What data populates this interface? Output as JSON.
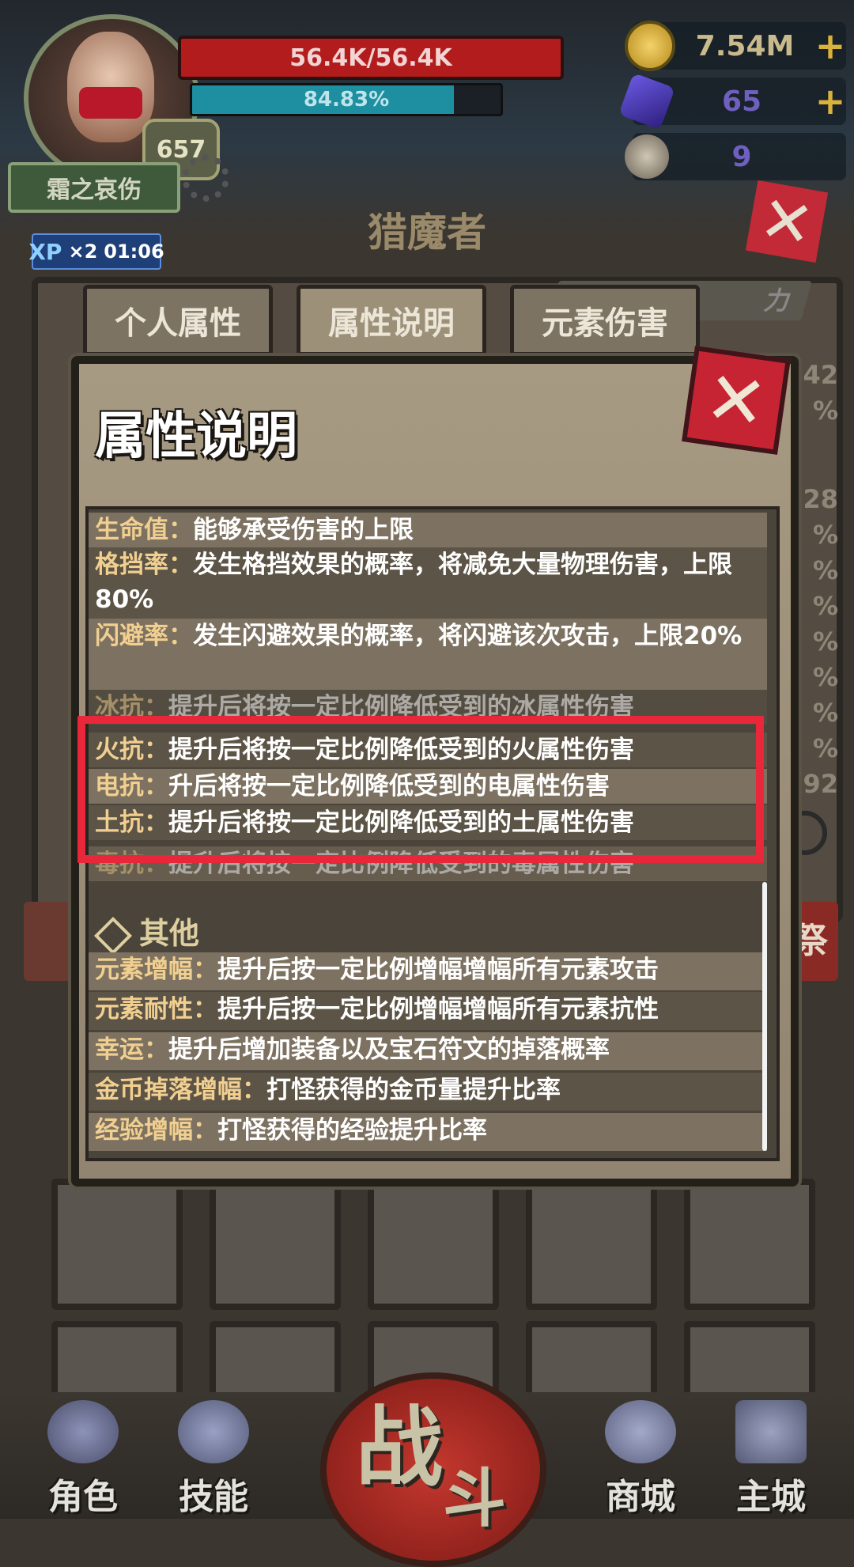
{
  "hud": {
    "hp_text": "56.4K/56.4K",
    "xp_text": "84.83%",
    "xp_progress": 0.8483,
    "level": "657",
    "player_name": "霜之哀伤",
    "resources": [
      {
        "icon": "gold-coin-icon",
        "value": "7.54M",
        "has_plus": true,
        "plus_label": "+"
      },
      {
        "icon": "purple-gem-icon",
        "value": "65",
        "has_plus": true,
        "plus_label": "+"
      },
      {
        "icon": "ram-skull-icon",
        "value": "9",
        "has_plus": false,
        "plus_label": ""
      }
    ],
    "xp_boost": {
      "label": "XP",
      "multiplier": "×2",
      "timer": "01:06"
    },
    "close_label": "✕"
  },
  "window": {
    "title": "猎魔者",
    "tabs": [
      {
        "label": "个人属性",
        "active": false
      },
      {
        "label": "属性说明",
        "active": true
      },
      {
        "label": "元素伤害",
        "active": false
      }
    ],
    "power_tag": "力",
    "side_right_label": "祭",
    "back_numbers": [
      "42",
      "%",
      "28",
      "%",
      "%",
      "%",
      "%",
      "%",
      "%",
      "%",
      "92"
    ]
  },
  "modal": {
    "title": "属性说明",
    "close_label": "✕",
    "rows": [
      {
        "key": "生命值：",
        "text": "能够承受伤害的上限"
      },
      {
        "key": "格挡率：",
        "text": "发生格挡效果的概率，将减免大量物理伤害，上限80%"
      },
      {
        "key": "闪避率：",
        "text": "发生闪避效果的概率，将闪避该次攻击，上限20%"
      },
      {
        "key": "冰抗：",
        "text": "提升后将按一定比例降低受到的冰属性伤害"
      },
      {
        "key": "火抗：",
        "text": "提升后将按一定比例降低受到的火属性伤害"
      },
      {
        "key": "电抗：",
        "text": "升后将按一定比例降低受到的电属性伤害"
      },
      {
        "key": "土抗：",
        "text": "提升后将按一定比例降低受到的土属性伤害"
      },
      {
        "key": "毒抗：",
        "text": "提升后将按一定比例降低受到的毒属性伤害"
      }
    ],
    "section_other": "其他",
    "other_rows": [
      {
        "key": "元素增幅：",
        "text": "提升后按一定比例增幅增幅所有元素攻击"
      },
      {
        "key": "元素耐性：",
        "text": "提升后按一定比例增幅增幅所有元素抗性"
      },
      {
        "key": "幸运：",
        "text": "提升后增加装备以及宝石符文的掉落概率"
      },
      {
        "key": "金币掉落增幅：",
        "text": "打怪获得的金币量提升比率"
      },
      {
        "key": "经验增幅：",
        "text": "打怪获得的经验提升比率"
      }
    ]
  },
  "nav": {
    "items": [
      {
        "label": "角色",
        "icon": "helmet-icon"
      },
      {
        "label": "技能",
        "icon": "swirl-icon"
      },
      {
        "label": "商城",
        "icon": "shop-icon"
      },
      {
        "label": "主城",
        "icon": "castle-icon"
      }
    ],
    "battle_1": "战",
    "battle_2": "斗"
  },
  "colors": {
    "highlight": "#e8283a",
    "key_text": "#f1cf90",
    "hp": "#b31c1c",
    "xp": "#1d8fa0"
  }
}
